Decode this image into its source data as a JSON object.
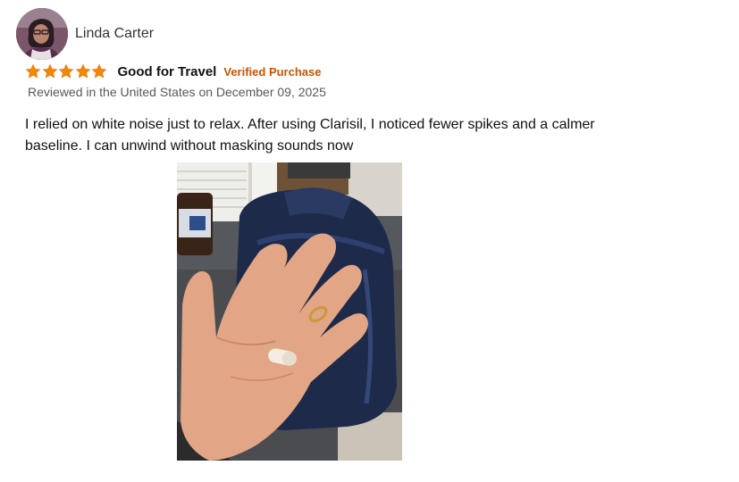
{
  "review": {
    "reviewer_name": "Linda Carter",
    "rating": 5,
    "rating_max": 5,
    "title": "Good for Travel",
    "verified_label": "Verified Purchase",
    "date_prefix": "Reviewed in the United States on December",
    "date_suffix": "09, 2025",
    "body": "I relied on white noise just to relax. After using Clarisil, I noticed fewer spikes and a calmer baseline. I can unwind without masking sounds now"
  },
  "colors": {
    "star": "#f08804",
    "star_outline": "#e47911",
    "verified": "#c45500",
    "date": "#565959",
    "body_text": "#0f1111"
  },
  "icons": {
    "star": "star-icon"
  }
}
